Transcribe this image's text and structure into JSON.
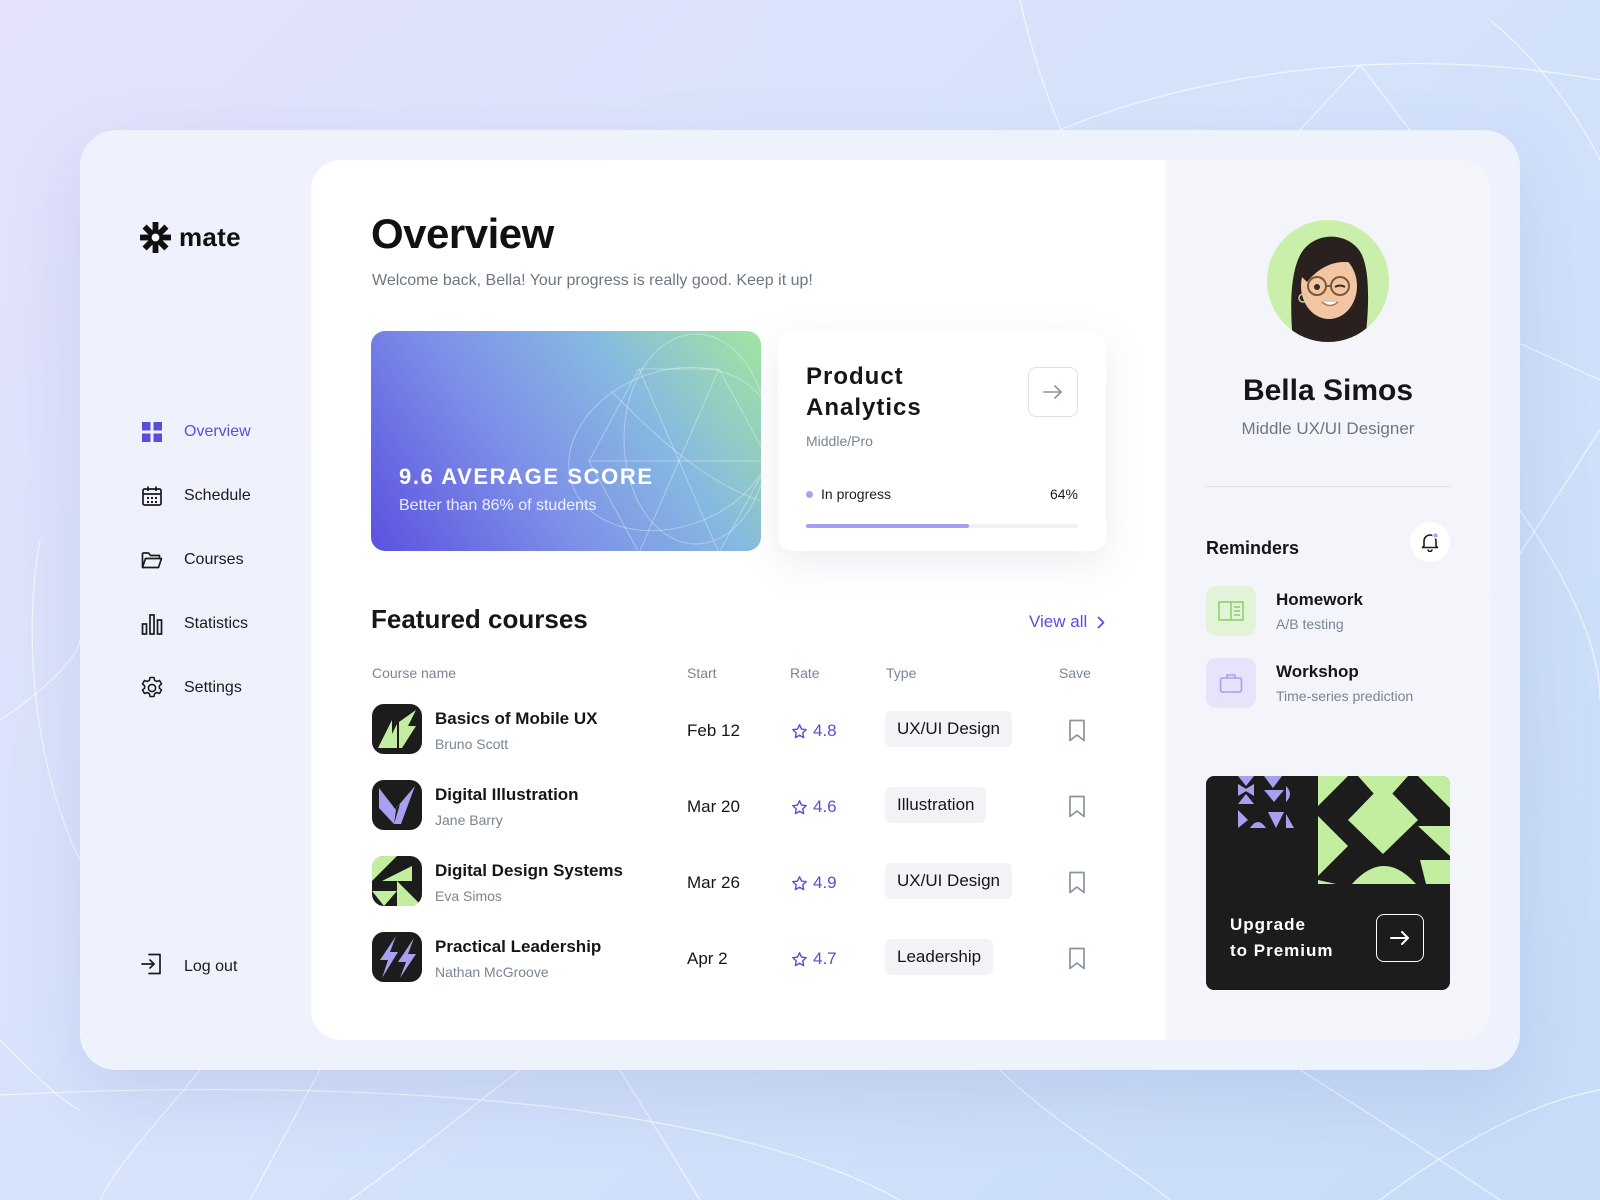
{
  "brand": {
    "name": "mate"
  },
  "nav": {
    "items": [
      {
        "label": "Overview",
        "icon": "grid-icon",
        "active": true
      },
      {
        "label": "Schedule",
        "icon": "calendar-icon",
        "active": false
      },
      {
        "label": "Courses",
        "icon": "folder-icon",
        "active": false
      },
      {
        "label": "Statistics",
        "icon": "bar-chart-icon",
        "active": false
      },
      {
        "label": "Settings",
        "icon": "gear-icon",
        "active": false
      }
    ],
    "logout": "Log out"
  },
  "header": {
    "title": "Overview",
    "subtitle": "Welcome back, Bella! Your progress is really good. Keep it up!"
  },
  "score_card": {
    "title": "9.6 AVERAGE SCORE",
    "subtitle": "Better than 86% of students"
  },
  "current_course": {
    "title": "Product Analytics",
    "level": "Middle/Pro",
    "status": "In progress",
    "progress_label": "64%",
    "progress": 0.6
  },
  "featured": {
    "title": "Featured courses",
    "view_all": "View all",
    "columns": [
      "Course name",
      "Start",
      "Rate",
      "Type",
      "Save"
    ],
    "rows": [
      {
        "name": "Basics of Mobile UX",
        "author": "Bruno Scott",
        "start": "Feb 12",
        "rate": "4.8",
        "type": "UX/UI Design",
        "thumb": "green-slash-pattern"
      },
      {
        "name": "Digital Illustration",
        "author": "Jane Barry",
        "start": "Mar 20",
        "rate": "4.6",
        "type": "Illustration",
        "thumb": "purple-arrow-pattern"
      },
      {
        "name": "Digital Design Systems",
        "author": "Eva Simos",
        "start": "Mar 26",
        "rate": "4.9",
        "type": "UX/UI Design",
        "thumb": "green-triangle-pattern"
      },
      {
        "name": "Practical Leadership",
        "author": "Nathan McGroove",
        "start": "Apr 2",
        "rate": "4.7",
        "type": "Leadership",
        "thumb": "purple-bolt-pattern"
      }
    ]
  },
  "profile": {
    "name": "Bella Simos",
    "role": "Middle UX/UI Designer"
  },
  "reminders": {
    "title": "Reminders",
    "items": [
      {
        "title": "Homework",
        "subtitle": "A/B testing",
        "icon": "book-icon"
      },
      {
        "title": "Workshop",
        "subtitle": "Time-series prediction",
        "icon": "briefcase-icon"
      }
    ]
  },
  "premium": {
    "line1": "Upgrade",
    "line2": "to Premium"
  },
  "colors": {
    "accent": "#5a4ed6",
    "lime": "#c4ee9f",
    "lavender": "#a79ff0",
    "dark": "#1c1c1c"
  }
}
